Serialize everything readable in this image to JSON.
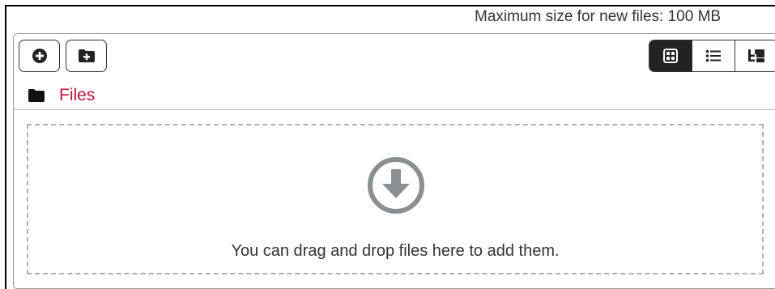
{
  "header": {
    "max_size_text": "Maximum size for new files: 100 MB"
  },
  "toolbar": {
    "buttons": [
      {
        "name": "add-file-button",
        "icon": "plus-circle-icon"
      },
      {
        "name": "create-folder-button",
        "icon": "folder-plus-icon"
      }
    ],
    "view_modes": [
      {
        "name": "view-icons-button",
        "icon": "grid-icon",
        "active": true
      },
      {
        "name": "view-details-button",
        "icon": "list-icon",
        "active": false
      },
      {
        "name": "view-tree-button",
        "icon": "tree-icon",
        "active": false
      }
    ]
  },
  "breadcrumb": {
    "icon": "folder-icon",
    "label": "Files"
  },
  "dropzone": {
    "icon": "download-circle-icon",
    "message": "You can drag and drop files here to add them."
  },
  "colors": {
    "link": "#c0143c",
    "active_view": "#222222",
    "dropzone_border": "#b0b0b0",
    "drop_icon": "#8a8f93"
  }
}
